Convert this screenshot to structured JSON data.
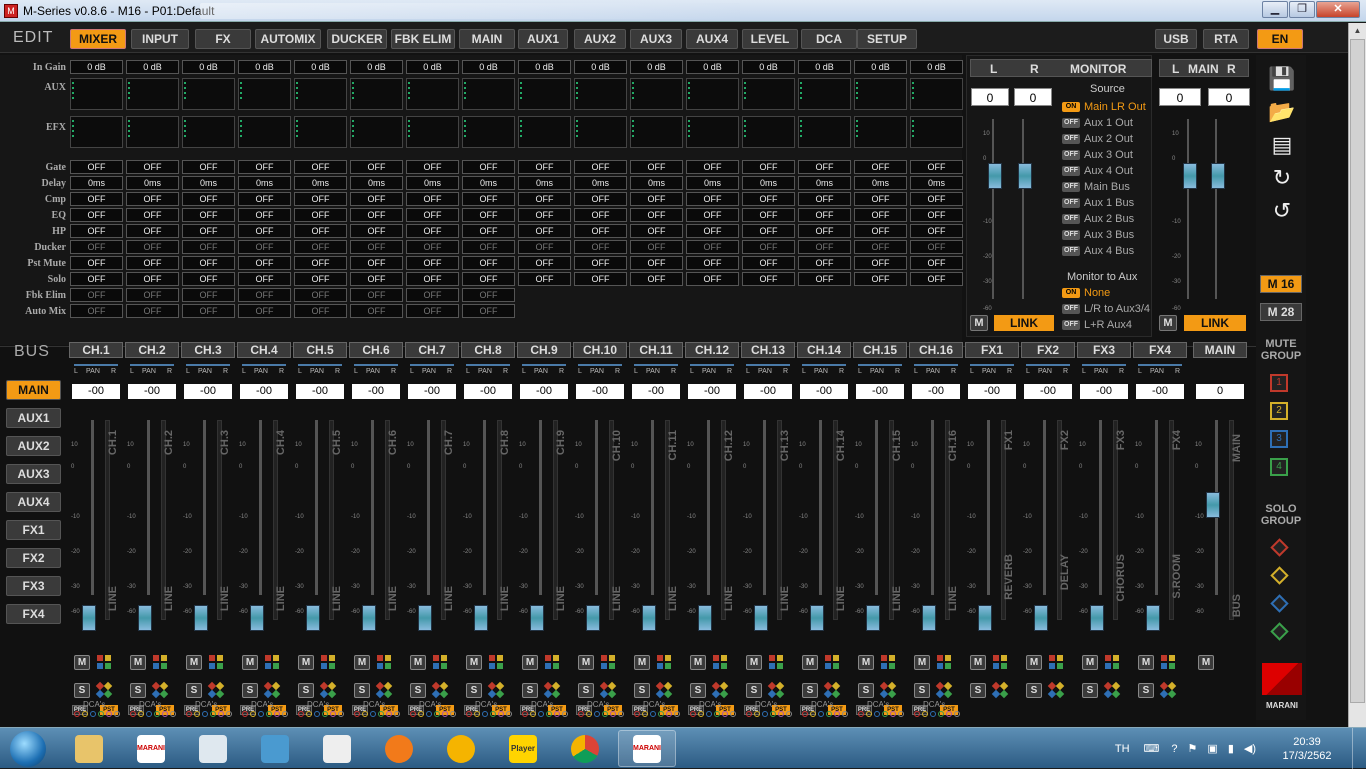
{
  "window": {
    "title": "M-Series v0.8.6 - M16 - P01:Default",
    "min": "▁",
    "max": "❐",
    "close": "✕"
  },
  "edit_label": "EDIT",
  "tabs": [
    "MIXER",
    "INPUT",
    "FX",
    "AUTOMIX",
    "DUCKER",
    "FBK ELIM",
    "MAIN",
    "AUX1",
    "AUX2",
    "AUX3",
    "AUX4",
    "LEVEL",
    "DCA",
    "SETUP"
  ],
  "top_right": [
    "USB",
    "RTA",
    "EN"
  ],
  "row_labels": [
    "In Gain",
    "AUX",
    "EFX",
    "Gate",
    "Delay",
    "Cmp",
    "EQ",
    "HP",
    "Ducker",
    "Pst Mute",
    "Solo",
    "Fbk Elim",
    "Auto Mix"
  ],
  "in_gain": "0 dB",
  "delay_val": "0ms",
  "off": "OFF",
  "monitor": {
    "l": "L",
    "r": "R",
    "title": "MONITOR",
    "l_val": "0",
    "r_val": "0",
    "source_title": "Source",
    "sources": [
      "Main LR Out",
      "Aux 1 Out",
      "Aux 2 Out",
      "Aux 3 Out",
      "Aux 4 Out",
      "Main Bus",
      "Aux 1 Bus",
      "Aux 2 Bus",
      "Aux 3 Bus",
      "Aux 4 Bus"
    ],
    "on_badge": "ON",
    "off_badge": "OFF",
    "to_aux_title": "Monitor to Aux",
    "to_aux": [
      "None",
      "L/R to Aux3/4",
      "L+R Aux4"
    ],
    "m": "M",
    "link": "LINK"
  },
  "main_block": {
    "l": "L",
    "title": "MAIN",
    "r": "R",
    "l_val": "0",
    "r_val": "0",
    "m": "M",
    "link": "LINK"
  },
  "ticks": [
    "10",
    "0",
    "-10",
    "-20",
    "-30",
    "-40",
    "-60"
  ],
  "right_panel": {
    "m16": "M 16",
    "m28": "M 28",
    "mute_group": "MUTE GROUP",
    "mute": [
      "1",
      "2",
      "3",
      "4"
    ],
    "solo_group": "SOLO GROUP",
    "solo": [
      "1",
      "2",
      "3",
      "4"
    ],
    "logo": "MARANI"
  },
  "colors": {
    "accent": "#f39a14",
    "grp": [
      "#c0392b",
      "#d4b02a",
      "#2e6fb5",
      "#3aa04a"
    ]
  },
  "bus_label": "BUS",
  "bus_buttons": [
    "MAIN",
    "AUX1",
    "AUX2",
    "AUX3",
    "AUX4",
    "FX1",
    "FX2",
    "FX3",
    "FX4"
  ],
  "channels": [
    "CH.1",
    "CH.2",
    "CH.3",
    "CH.4",
    "CH.5",
    "CH.6",
    "CH.7",
    "CH.8",
    "CH.9",
    "CH.10",
    "CH.11",
    "CH.12",
    "CH.13",
    "CH.14",
    "CH.15",
    "CH.16"
  ],
  "pan": {
    "l": "L",
    "pan": "PAN",
    "r": "R"
  },
  "pan_val": "-00",
  "line": "LINE",
  "fx": [
    {
      "name": "FX1",
      "type": "REVERB"
    },
    {
      "name": "FX2",
      "type": "DELAY"
    },
    {
      "name": "FX3",
      "type": "CHORUS"
    },
    {
      "name": "FX4",
      "type": "S.ROOM"
    }
  ],
  "main_strip": {
    "name": "MAIN",
    "val": "0",
    "vert": "MAIN",
    "bus": "BUS"
  },
  "btn": {
    "m": "M",
    "s": "S",
    "pre": "PRE",
    "pst": "PST",
    "dca": "DCA's"
  },
  "taskbar": {
    "lang": "TH",
    "time": "20:39",
    "date": "17/3/2562",
    "player": "Player",
    "marani": "MARANI"
  }
}
